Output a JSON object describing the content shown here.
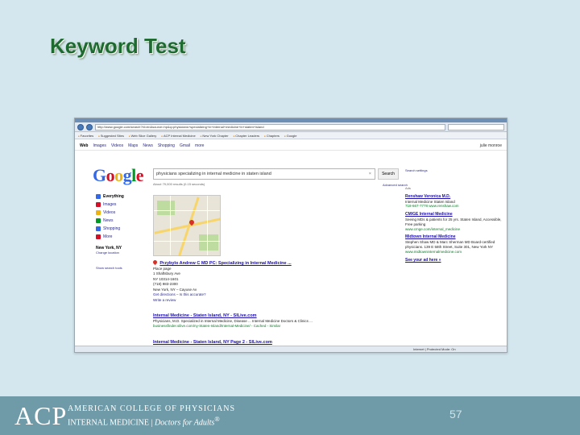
{
  "slide": {
    "title": "Keyword Test",
    "page_number": "57"
  },
  "footer": {
    "logo": "ACP",
    "org_name": "AMERICAN COLLEGE OF PHYSICIANS",
    "tagline_main": "INTERNAL MEDICINE",
    "tagline_sep": " | ",
    "tagline_italic": "Doctors for Adults",
    "tagline_mark": "®"
  },
  "browser": {
    "url": "http://www.google.com/search?hl=en&source=hp&q=physicians+specializing+in+internal+medicine+in+staten+island",
    "favorites": [
      "Favorites",
      "Suggested Sites",
      "Web Slice Gallery",
      "ACP Internal Medicine",
      "New York Chapter",
      "Chapter Leaders",
      "Chapters",
      "Google"
    ],
    "status_text": "Internet | Protected Mode: On"
  },
  "google": {
    "topnav": [
      "Web",
      "Images",
      "Videos",
      "Maps",
      "News",
      "Shopping",
      "Gmail",
      "more"
    ],
    "topnav_right": "julie monroe",
    "logo_letters": [
      {
        "ch": "G",
        "cls": "b"
      },
      {
        "ch": "o",
        "cls": "r"
      },
      {
        "ch": "o",
        "cls": "y"
      },
      {
        "ch": "g",
        "cls": "b"
      },
      {
        "ch": "l",
        "cls": "g"
      },
      {
        "ch": "e",
        "cls": "r"
      }
    ],
    "query": "physicians specializing in internal medicine in staten island",
    "search_button": "Search",
    "advanced_search": "Advanced search",
    "search_settings": "Search settings",
    "results_count": "About 79,000 results (0.15 seconds)",
    "leftnav": [
      {
        "label": "Everything",
        "color": "#3369e8",
        "selected": true
      },
      {
        "label": "Images",
        "color": "#d50f25",
        "selected": false
      },
      {
        "label": "Videos",
        "color": "#eeb211",
        "selected": false
      },
      {
        "label": "News",
        "color": "#009925",
        "selected": false
      },
      {
        "label": "Shopping",
        "color": "#3369e8",
        "selected": false
      },
      {
        "label": "More",
        "color": "#d50f25",
        "selected": false
      }
    ],
    "location": "New York, NY",
    "change_location": "Change location",
    "show_options": "Show search tools"
  },
  "results": [
    {
      "title": "Przybylo Andrew C MD PC: Specializing in Internal Medicine ...",
      "lines": [
        "Place page",
        "1 Shaftsbury Ave",
        "NY 10314-1601",
        "(718) 983-2300",
        "New York, NY – Cayuse Av"
      ],
      "link": "Get directions – Is this accurate?",
      "extra": "Write a review"
    },
    {
      "title": "Internal Medicine - Staten Island, NY - SILive.com",
      "snippet": "Physicians, M.D. Specialized in Internal Medicine, Disease ... Internal Medicine Doctors & Clinics ...",
      "url": "businessfinder.silive.com/ny-Staten-Island/Internal-Medicine/ - Cached - Similar"
    },
    {
      "title": "Internal Medicine - Staten Island, NY Page 2 - SILive.com",
      "snippet": "",
      "url": ""
    }
  ],
  "ads": {
    "header": "Ads",
    "items": [
      {
        "title": "Renshaw Veronica M.D.",
        "desc": "Internal Medicine Staten Island",
        "url": "718-667-7778 www.renshaw.com"
      },
      {
        "title": "CM/GE Internal Medicine",
        "desc": "Seeing MDs & patients for 25 yrs. Staten Island, Accessible, Free parking",
        "url": "www.cmge.com/internal_medicine"
      },
      {
        "title": "Midtown Internal Medicine",
        "desc": "Stephen Shaw MD & Marc Sherman MD Board-certified physicians. 139 E 58th Street, Suite 301, New York NY",
        "url": "www.midtowninternalmedicine.com"
      },
      {
        "title": "See your ad here »",
        "desc": "",
        "url": ""
      }
    ]
  }
}
